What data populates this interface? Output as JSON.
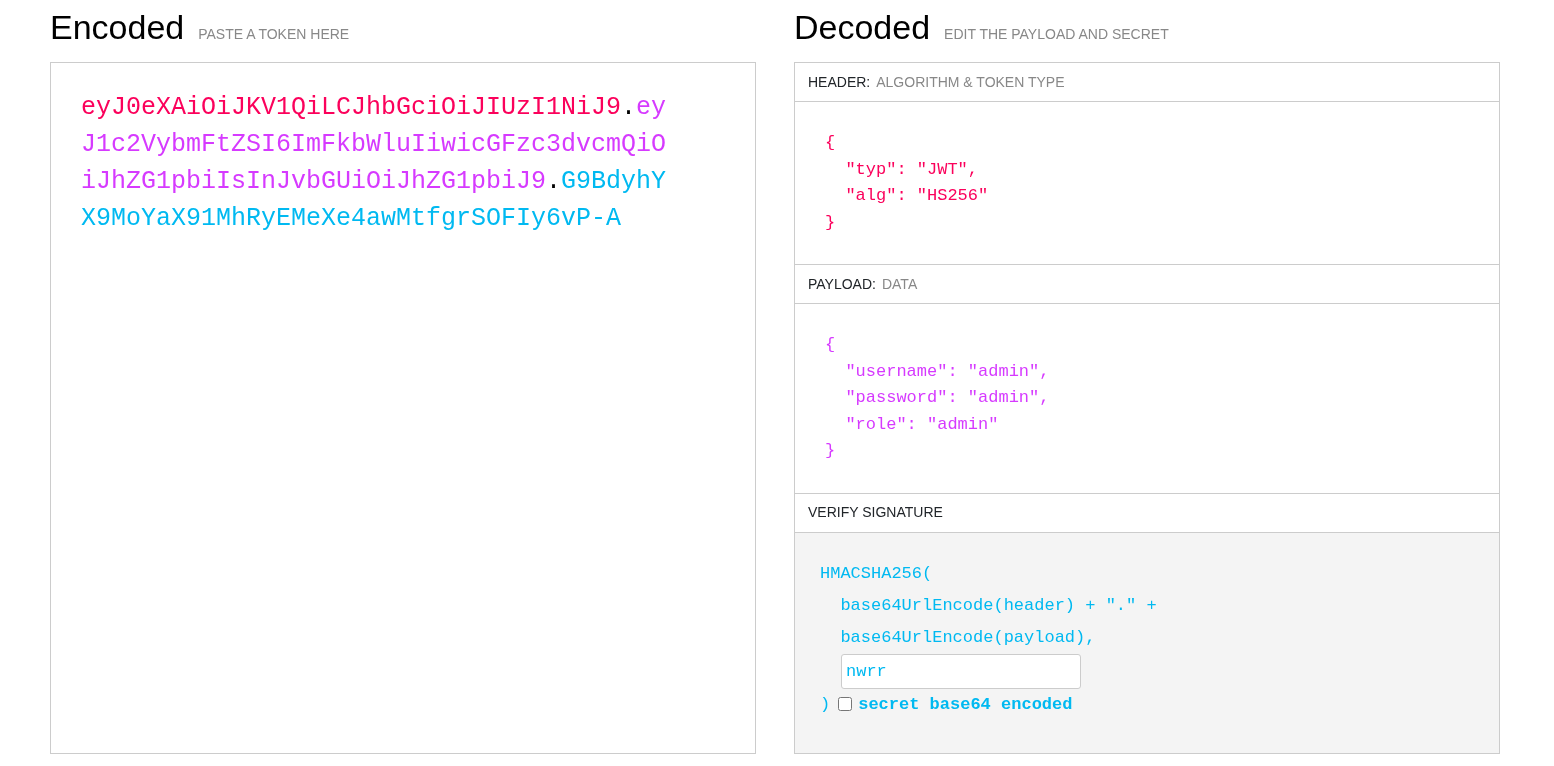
{
  "encoded": {
    "title": "Encoded",
    "subtitle": "PASTE A TOKEN HERE",
    "token": [
      {
        "kind": "part",
        "text": "eyJ0eXAiOiJKV1QiLCJhbGciOiJIUzI1NiJ9",
        "color": "#fb015b"
      },
      {
        "kind": "dot",
        "text": "."
      },
      {
        "kind": "part",
        "text": "eyJ1c2VybmFtZSI6ImFkbWluIiwicGFzc3dvcmQiOiJhZG1pbiIsInJvbGUiOiJhZG1pbiJ9",
        "color": "#d63aff"
      },
      {
        "kind": "dot",
        "text": "."
      },
      {
        "kind": "part",
        "text": "G9BdyhYX9MoYaX91MhRyEMeXe4awMtfgrSOFIy6vP-A",
        "color": "#00b9f1"
      }
    ]
  },
  "decoded": {
    "title": "Decoded",
    "subtitle": "EDIT THE PAYLOAD AND SECRET",
    "sections": [
      {
        "kind": "json",
        "label": "HEADER:",
        "sublabel": "ALGORITHM & TOKEN TYPE",
        "color": "#fb015b",
        "lines": [
          "{",
          "  \"typ\": \"JWT\",",
          "  \"alg\": \"HS256\"",
          "}"
        ]
      },
      {
        "kind": "json",
        "label": "PAYLOAD:",
        "sublabel": "DATA",
        "color": "#d63aff",
        "lines": [
          "{",
          "  \"username\": \"admin\",",
          "  \"password\": \"admin\",",
          "  \"role\": \"admin\"",
          "}"
        ]
      },
      {
        "kind": "verify",
        "label": "VERIFY SIGNATURE",
        "color": "#00b9f1",
        "lines": [
          "HMACSHA256(",
          "  base64UrlEncode(header) + \".\" +",
          "  base64UrlEncode(payload),"
        ],
        "secret": "nwrr",
        "closing": ")",
        "checkbox_label": "secret base64 encoded",
        "checked": false
      }
    ]
  }
}
